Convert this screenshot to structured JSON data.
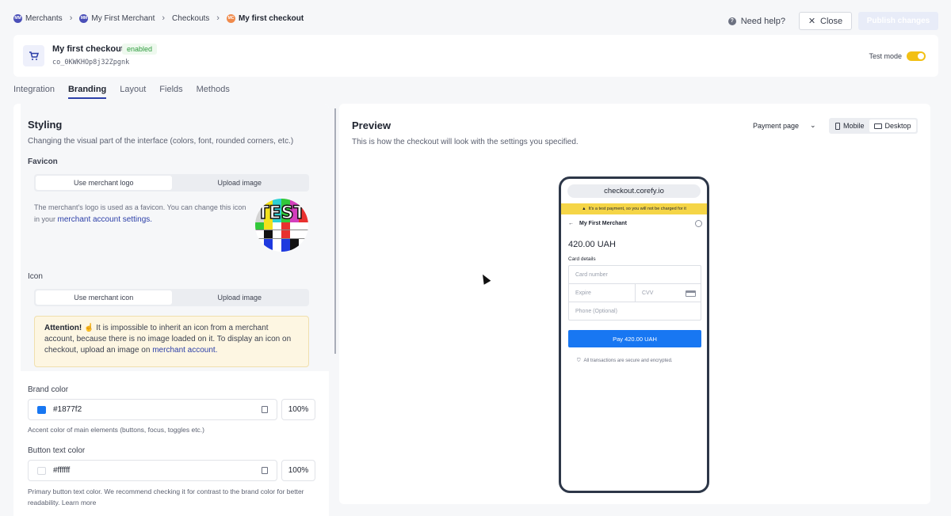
{
  "breadcrumb": [
    {
      "badge": "MM",
      "label": "Merchants"
    },
    {
      "badge": "MM",
      "label": "My First Merchant"
    },
    {
      "badge": "",
      "label": "Checkouts"
    },
    {
      "badge": "MC",
      "label": "My first checkout"
    }
  ],
  "top_actions": {
    "help_label": "Need help?",
    "close_label": "Close",
    "publish_label": "Publish changes"
  },
  "checkout": {
    "title": "My first checkout",
    "status": "enabled",
    "id": "co_0KWKHOp8j32Zpgnk",
    "test_mode_label": "Test mode",
    "test_mode_on": true
  },
  "tabs": [
    "Integration",
    "Branding",
    "Layout",
    "Fields",
    "Methods"
  ],
  "styling": {
    "title": "Styling",
    "subtitle": "Changing the visual part of the interface (colors, font, rounded corners, etc.)",
    "favicon": {
      "label": "Favicon",
      "options": [
        "Use merchant logo",
        "Upload image"
      ],
      "note": "The merchant's logo is used as a favicon. You can change this icon in your",
      "link": "merchant account settings.",
      "logo_text": "TEST"
    },
    "icon": {
      "label": "Icon",
      "options": [
        "Use merchant icon",
        "Upload image"
      ],
      "attention_title": "Attention!",
      "attention_text": "It is impossible to inherit an icon from a merchant account, because there is no image loaded on it. To display an icon on checkout, upload an image on",
      "attention_link": "merchant account."
    },
    "brand_color": {
      "label": "Brand color",
      "value": "#1877f2",
      "opacity": "100%",
      "note": "Accent color of main elements (buttons, focus, toggles etc.)"
    },
    "button_text_color": {
      "label": "Button text color",
      "value": "#ffffff",
      "opacity": "100%",
      "note": "Primary button text color. We recommend checking it for contrast to the brand color for better readability. Learn more"
    }
  },
  "preview": {
    "title": "Preview",
    "subtitle": "This is how the checkout will look with the settings you specified.",
    "page_select": "Payment page",
    "devices": [
      "Mobile",
      "Desktop"
    ],
    "active_device": "Desktop",
    "phone": {
      "url": "checkout.corefy.io",
      "test_banner": "It's a test payment, so you will not be charged for it",
      "merchant": "My First Merchant",
      "amount": "420.00 UAH",
      "card_details_label": "Card details",
      "card_number_placeholder": "Card number",
      "expire_placeholder": "Expire",
      "cvv_placeholder": "CVV",
      "phone_placeholder": "Phone (Optional)",
      "pay_label": "Pay 420.00 UAH",
      "secure_note": "All transactions are secure and encrypted."
    }
  },
  "colors": {
    "brand": "#1877f2",
    "accent": "#2c3fa8",
    "toggle": "#f2c014"
  }
}
